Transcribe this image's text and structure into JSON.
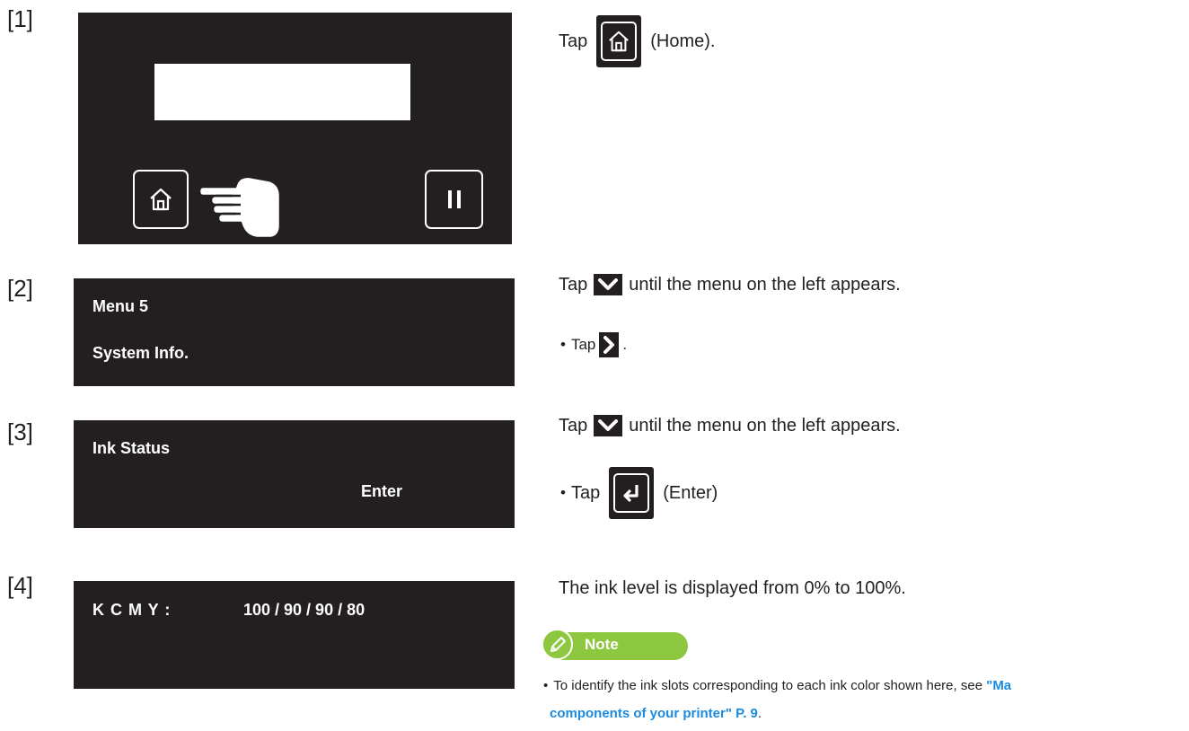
{
  "steps": [
    {
      "num": "[1]",
      "instruction_prefix": "Tap",
      "instruction_suffix": "(Home).",
      "home_icon": "home-icon",
      "pause_icon": "pause-icon",
      "hand_icon": "pointing-hand-icon"
    },
    {
      "num": "[2]",
      "lcd_line1": "Menu 5",
      "lcd_line2": "System Info.",
      "instruction_prefix": "Tap",
      "instruction_suffix": "until the menu on the left appears.",
      "sub_prefix": "Tap",
      "sub_suffix": "."
    },
    {
      "num": "[3]",
      "lcd_line1": "Ink Status",
      "lcd_line2": "Enter",
      "instruction_prefix": "Tap",
      "instruction_suffix": "until the menu on the left appears.",
      "sub_prefix": "Tap",
      "sub_suffix": "(Enter)"
    },
    {
      "num": "[4]",
      "lcd_label": "K C M Y :",
      "lcd_value": "100 / 90 / 90 / 80",
      "instruction": "The ink level is displayed from 0% to 100%."
    }
  ],
  "bullet": "•",
  "note": {
    "title": "Note",
    "text_before": "To identify the ink slots corresponding to each ink color shown here, see ",
    "link_part1": "\"Ma",
    "link_part2": "components of your printer\" P. 9",
    "text_after": "."
  },
  "colors": {
    "panel": "#231f20",
    "link": "#1a8be0",
    "note_green": "#8dc63f"
  }
}
